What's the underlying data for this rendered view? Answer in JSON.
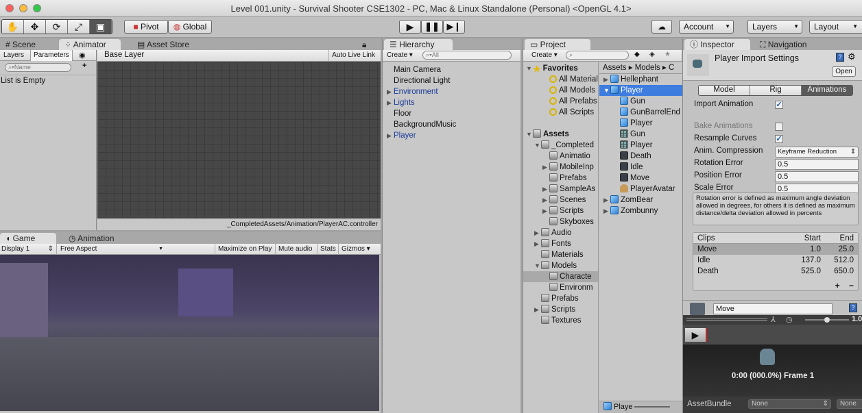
{
  "window": {
    "title": "Level 001.unity - Survival Shooter CSE1302 - PC, Mac & Linux Standalone (Personal) <OpenGL 4.1>"
  },
  "toolbar": {
    "tools": [
      "hand-icon",
      "move-icon",
      "rotate-icon",
      "scale-icon",
      "rect-icon"
    ],
    "pivot": "Pivot",
    "global": "Global",
    "account": "Account",
    "layers": "Layers",
    "layout": "Layout"
  },
  "animator": {
    "tabs": [
      "Scene",
      "Animator",
      "Asset Store"
    ],
    "subtabs": [
      "Layers",
      "Parameters"
    ],
    "search_placeholder": "Name",
    "empty": "List is Empty",
    "base_layer": "Base Layer",
    "auto_live_link": "Auto Live Link",
    "controller_path": "_CompletedAssets/Animation/PlayerAC.controller"
  },
  "game": {
    "tabs": [
      "Game",
      "Animation"
    ],
    "display": "Display 1",
    "aspect": "Free Aspect",
    "maximize": "Maximize on Play",
    "mute": "Mute audio",
    "stats": "Stats",
    "gizmos": "Gizmos"
  },
  "hierarchy": {
    "tab": "Hierarchy",
    "create": "Create",
    "search_placeholder": "All",
    "items": [
      {
        "label": "Main Camera",
        "arrow": false,
        "blue": false
      },
      {
        "label": "Directional Light",
        "arrow": false,
        "blue": false
      },
      {
        "label": "Environment",
        "arrow": true,
        "blue": true
      },
      {
        "label": "Lights",
        "arrow": true,
        "blue": true
      },
      {
        "label": "Floor",
        "arrow": false,
        "blue": false
      },
      {
        "label": "BackgroundMusic",
        "arrow": false,
        "blue": false
      },
      {
        "label": "Player",
        "arrow": true,
        "blue": true
      }
    ]
  },
  "project": {
    "tab": "Project",
    "create": "Create",
    "breadcrumb": [
      "Assets",
      "Models",
      "C"
    ],
    "left": [
      {
        "label": "Favorites",
        "depth": 0,
        "arrow": "open",
        "icon": "star",
        "bold": true
      },
      {
        "label": "All Materials",
        "depth": 2,
        "icon": "mag"
      },
      {
        "label": "All Models",
        "depth": 2,
        "icon": "mag"
      },
      {
        "label": "All Prefabs",
        "depth": 2,
        "icon": "mag"
      },
      {
        "label": "All Scripts",
        "depth": 2,
        "icon": "mag"
      },
      {
        "label": "",
        "depth": 0,
        "icon": ""
      },
      {
        "label": "Assets",
        "depth": 0,
        "arrow": "open",
        "icon": "folder",
        "bold": true
      },
      {
        "label": "_Completed",
        "depth": 1,
        "arrow": "open",
        "icon": "folder"
      },
      {
        "label": "Animatio",
        "depth": 2,
        "icon": "folder"
      },
      {
        "label": "MobileInp",
        "depth": 2,
        "arrow": "closed",
        "icon": "folder"
      },
      {
        "label": "Prefabs",
        "depth": 2,
        "icon": "folder"
      },
      {
        "label": "SampleAs",
        "depth": 2,
        "arrow": "closed",
        "icon": "folder"
      },
      {
        "label": "Scenes",
        "depth": 2,
        "arrow": "closed",
        "icon": "folder"
      },
      {
        "label": "Scripts",
        "depth": 2,
        "arrow": "closed",
        "icon": "folder"
      },
      {
        "label": "Skyboxes",
        "depth": 2,
        "icon": "folder"
      },
      {
        "label": "Audio",
        "depth": 1,
        "arrow": "closed",
        "icon": "folder"
      },
      {
        "label": "Fonts",
        "depth": 1,
        "arrow": "closed",
        "icon": "folder"
      },
      {
        "label": "Materials",
        "depth": 1,
        "icon": "folder"
      },
      {
        "label": "Models",
        "depth": 1,
        "arrow": "open",
        "icon": "folder"
      },
      {
        "label": "Characte",
        "depth": 2,
        "icon": "folder",
        "dim": true
      },
      {
        "label": "Environm",
        "depth": 2,
        "icon": "folder"
      },
      {
        "label": "Prefabs",
        "depth": 1,
        "icon": "folder"
      },
      {
        "label": "Scripts",
        "depth": 1,
        "arrow": "closed",
        "icon": "folder"
      },
      {
        "label": "Textures",
        "depth": 1,
        "icon": "folder"
      }
    ],
    "right": [
      {
        "label": "Hellephant",
        "depth": 0,
        "arrow": "closed",
        "icon": "cube"
      },
      {
        "label": "Player",
        "depth": 0,
        "arrow": "open",
        "icon": "cube",
        "selected": true
      },
      {
        "label": "Gun",
        "depth": 1,
        "icon": "cube"
      },
      {
        "label": "GunBarrelEnd",
        "depth": 1,
        "icon": "cube"
      },
      {
        "label": "Player",
        "depth": 1,
        "icon": "cube"
      },
      {
        "label": "Gun",
        "depth": 1,
        "icon": "mesh"
      },
      {
        "label": "Player",
        "depth": 1,
        "icon": "mesh"
      },
      {
        "label": "Death",
        "depth": 1,
        "icon": "clip"
      },
      {
        "label": "Idle",
        "depth": 1,
        "icon": "clip"
      },
      {
        "label": "Move",
        "depth": 1,
        "icon": "clip"
      },
      {
        "label": "PlayerAvatar",
        "depth": 1,
        "icon": "avatar"
      },
      {
        "label": "ZomBear",
        "depth": 0,
        "arrow": "closed",
        "icon": "cube"
      },
      {
        "label": "Zombunny",
        "depth": 0,
        "arrow": "closed",
        "icon": "cube"
      }
    ],
    "footer": "Playe"
  },
  "inspector": {
    "tabs": [
      "Inspector",
      "Navigation"
    ],
    "title": "Player Import Settings",
    "open": "Open",
    "segments": [
      "Model",
      "Rig",
      "Animations"
    ],
    "import_animation": {
      "label": "Import Animation",
      "checked": true
    },
    "bake_animations": {
      "label": "Bake Animations",
      "checked": false
    },
    "resample_curves": {
      "label": "Resample Curves",
      "checked": true
    },
    "anim_compression": {
      "label": "Anim. Compression",
      "value": "Keyframe Reduction"
    },
    "rotation_error": {
      "label": "Rotation Error",
      "value": "0.5"
    },
    "position_error": {
      "label": "Position Error",
      "value": "0.5"
    },
    "scale_error": {
      "label": "Scale Error",
      "value": "0.5"
    },
    "help": "Rotation error is defined as maximum angle deviation allowed in degrees, for others it is defined as maximum distance/delta deviation allowed in percents",
    "clips_header": [
      "Clips",
      "Start",
      "End"
    ],
    "clips": [
      {
        "name": "Move",
        "start": "1.0",
        "end": "25.0"
      },
      {
        "name": "Idle",
        "start": "137.0",
        "end": "512.0"
      },
      {
        "name": "Death",
        "start": "525.0",
        "end": "650.0"
      }
    ],
    "add": "+",
    "remove": "−",
    "clip_name": "Move",
    "speed": "1.0",
    "preview_time": "0:00 (000.0%) Frame 1",
    "assetbundle_label": "AssetBundle",
    "assetbundle": "None",
    "variant": "None"
  },
  "colors": {
    "selection": "#3e7de0",
    "panel": "#c2c2c2",
    "grid": "#474747"
  }
}
